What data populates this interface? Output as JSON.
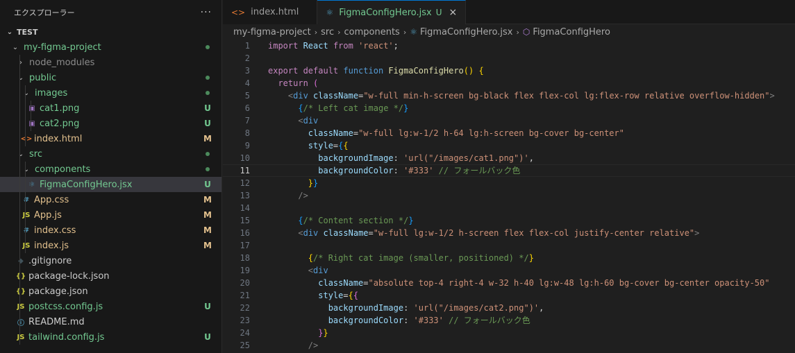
{
  "sidebar": {
    "title": "エクスプローラー",
    "more": "···",
    "section": "TEST",
    "items": [
      {
        "name": "my-figma-project",
        "indent": 1,
        "chevron": "down",
        "color": "green",
        "status": "dot"
      },
      {
        "name": "node_modules",
        "indent": 2,
        "chevron": "right",
        "color": "dim",
        "status": ""
      },
      {
        "name": "public",
        "indent": 2,
        "chevron": "down",
        "color": "green",
        "status": "dot"
      },
      {
        "name": "images",
        "indent": 3,
        "chevron": "down",
        "color": "green",
        "status": "dot"
      },
      {
        "name": "cat1.png",
        "indent": 4,
        "icon": "image",
        "color": "green",
        "status": "U"
      },
      {
        "name": "cat2.png",
        "indent": 4,
        "icon": "image",
        "color": "green",
        "status": "U"
      },
      {
        "name": "index.html",
        "indent": 3,
        "icon": "html",
        "color": "yellow",
        "status": "M"
      },
      {
        "name": "src",
        "indent": 2,
        "chevron": "down",
        "color": "green",
        "status": "dot"
      },
      {
        "name": "components",
        "indent": 3,
        "chevron": "down",
        "color": "green",
        "status": "dot"
      },
      {
        "name": "FigmaConfigHero.jsx",
        "indent": 4,
        "icon": "react",
        "color": "green",
        "status": "U",
        "selected": true
      },
      {
        "name": "App.css",
        "indent": 3,
        "icon": "css",
        "color": "yellow",
        "status": "M"
      },
      {
        "name": "App.js",
        "indent": 3,
        "icon": "js",
        "color": "yellow",
        "status": "M"
      },
      {
        "name": "index.css",
        "indent": 3,
        "icon": "css",
        "color": "yellow",
        "status": "M"
      },
      {
        "name": "index.js",
        "indent": 3,
        "icon": "js",
        "color": "yellow",
        "status": "M"
      },
      {
        "name": ".gitignore",
        "indent": 2,
        "icon": "git",
        "color": "gray",
        "status": ""
      },
      {
        "name": "package-lock.json",
        "indent": 2,
        "icon": "json",
        "color": "gray",
        "status": ""
      },
      {
        "name": "package.json",
        "indent": 2,
        "icon": "json",
        "color": "gray",
        "status": ""
      },
      {
        "name": "postcss.config.js",
        "indent": 2,
        "icon": "js",
        "color": "green",
        "status": "U"
      },
      {
        "name": "README.md",
        "indent": 2,
        "icon": "info",
        "color": "gray",
        "status": ""
      },
      {
        "name": "tailwind.config.js",
        "indent": 2,
        "icon": "js",
        "color": "green",
        "status": "U"
      }
    ]
  },
  "tabs": [
    {
      "label": "index.html",
      "icon": "html",
      "active": false
    },
    {
      "label": "FigmaConfigHero.jsx",
      "icon": "react",
      "active": true,
      "badge": "U",
      "close": "×"
    }
  ],
  "breadcrumb": [
    "my-figma-project",
    "src",
    "components",
    "FigmaConfigHero.jsx",
    "FigmaConfigHero"
  ],
  "current_line": 11,
  "code": [
    [
      [
        "kw",
        "import"
      ],
      [
        "id",
        " React "
      ],
      [
        "kw",
        "from"
      ],
      [
        "st",
        " 'react'"
      ],
      [
        "pn",
        ";"
      ]
    ],
    [],
    [
      [
        "kw",
        "export"
      ],
      [
        "kw",
        " default"
      ],
      [
        "sk",
        " function"
      ],
      [
        "fn",
        " FigmaConfigHero"
      ],
      [
        "br1",
        "()"
      ],
      [
        "pn",
        " "
      ],
      [
        "br1",
        "{"
      ]
    ],
    [
      [
        "pn",
        "  "
      ],
      [
        "kw",
        "return"
      ],
      [
        "pn",
        " "
      ],
      [
        "br2",
        "("
      ]
    ],
    [
      [
        "pn",
        "    "
      ],
      [
        "gr",
        "<"
      ],
      [
        "tg",
        "div"
      ],
      [
        "at",
        " className"
      ],
      [
        "pn",
        "="
      ],
      [
        "st",
        "\"w-full min-h-screen bg-black flex flex-col lg:flex-row relative overflow-hidden\""
      ],
      [
        "gr",
        ">"
      ]
    ],
    [
      [
        "pn",
        "      "
      ],
      [
        "br3",
        "{"
      ],
      [
        "cm",
        "/* Left cat image */"
      ],
      [
        "br3",
        "}"
      ]
    ],
    [
      [
        "pn",
        "      "
      ],
      [
        "gr",
        "<"
      ],
      [
        "tg",
        "div"
      ]
    ],
    [
      [
        "pn",
        "        "
      ],
      [
        "at",
        "className"
      ],
      [
        "pn",
        "="
      ],
      [
        "st",
        "\"w-full lg:w-1/2 h-64 lg:h-screen bg-cover bg-center\""
      ]
    ],
    [
      [
        "pn",
        "        "
      ],
      [
        "at",
        "style"
      ],
      [
        "pn",
        "="
      ],
      [
        "br3",
        "{"
      ],
      [
        "br1",
        "{"
      ]
    ],
    [
      [
        "pn",
        "          "
      ],
      [
        "id",
        "backgroundImage"
      ],
      [
        "pn",
        ": "
      ],
      [
        "st",
        "'url(\"/images/cat1.png\")'"
      ],
      [
        "pn",
        ","
      ]
    ],
    [
      [
        "pn",
        "          "
      ],
      [
        "id",
        "backgroundColor"
      ],
      [
        "pn",
        ": "
      ],
      [
        "st",
        "'#333'"
      ],
      [
        "cm",
        " // フォールバック色"
      ]
    ],
    [
      [
        "pn",
        "        "
      ],
      [
        "br1",
        "}"
      ],
      [
        "br3",
        "}"
      ]
    ],
    [
      [
        "pn",
        "      "
      ],
      [
        "gr",
        "/>"
      ]
    ],
    [],
    [
      [
        "pn",
        "      "
      ],
      [
        "br3",
        "{"
      ],
      [
        "cm",
        "/* Content section */"
      ],
      [
        "br3",
        "}"
      ]
    ],
    [
      [
        "pn",
        "      "
      ],
      [
        "gr",
        "<"
      ],
      [
        "tg",
        "div"
      ],
      [
        "at",
        " className"
      ],
      [
        "pn",
        "="
      ],
      [
        "st",
        "\"w-full lg:w-1/2 h-screen flex flex-col justify-center relative\""
      ],
      [
        "gr",
        ">"
      ]
    ],
    [],
    [
      [
        "pn",
        "        "
      ],
      [
        "br1",
        "{"
      ],
      [
        "cm",
        "/* Right cat image (smaller, positioned) */"
      ],
      [
        "br1",
        "}"
      ]
    ],
    [
      [
        "pn",
        "        "
      ],
      [
        "gr",
        "<"
      ],
      [
        "tg",
        "div"
      ]
    ],
    [
      [
        "pn",
        "          "
      ],
      [
        "at",
        "className"
      ],
      [
        "pn",
        "="
      ],
      [
        "st",
        "\"absolute top-4 right-4 w-32 h-40 lg:w-48 lg:h-60 bg-cover bg-center opacity-50\""
      ]
    ],
    [
      [
        "pn",
        "          "
      ],
      [
        "at",
        "style"
      ],
      [
        "pn",
        "="
      ],
      [
        "br1",
        "{"
      ],
      [
        "br2",
        "{"
      ]
    ],
    [
      [
        "pn",
        "            "
      ],
      [
        "id",
        "backgroundImage"
      ],
      [
        "pn",
        ": "
      ],
      [
        "st",
        "'url(\"/images/cat2.png\")'"
      ],
      [
        "pn",
        ","
      ]
    ],
    [
      [
        "pn",
        "            "
      ],
      [
        "id",
        "backgroundColor"
      ],
      [
        "pn",
        ": "
      ],
      [
        "st",
        "'#333'"
      ],
      [
        "cm",
        " // フォールバック色"
      ]
    ],
    [
      [
        "pn",
        "          "
      ],
      [
        "br2",
        "}"
      ],
      [
        "br1",
        "}"
      ]
    ],
    [
      [
        "pn",
        "        "
      ],
      [
        "gr",
        "/>"
      ]
    ]
  ]
}
